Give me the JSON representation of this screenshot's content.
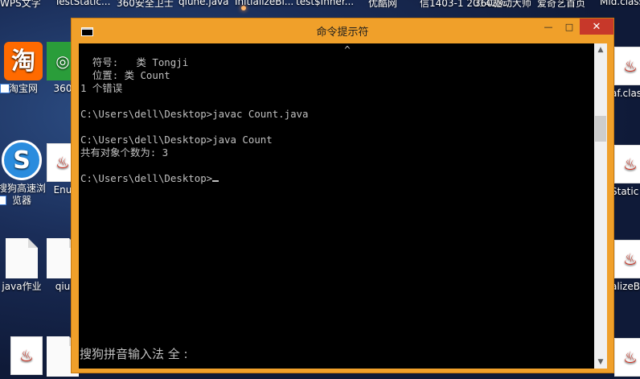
{
  "taskbar": {
    "items": [
      "WPS文字",
      "TestStatic...",
      "360安全卫士",
      "qiune.java",
      "InitializeBl...",
      "test$Inner...",
      "优酷网",
      "信1403-1 201429...",
      "360驱动大师",
      "爱奇艺首页",
      "Mid.class"
    ]
  },
  "desktop_left": [
    {
      "label": "淘宝网",
      "icon": "taobao-icon"
    },
    {
      "label": "360",
      "icon": "app-icon"
    },
    {
      "label": "搜狗高速浏览器",
      "icon": "sogou-browser-icon"
    },
    {
      "label": "Enu",
      "icon": "java-file-icon"
    },
    {
      "label": "java作业",
      "icon": "file-icon"
    },
    {
      "label": "qiu",
      "icon": "file-icon"
    }
  ],
  "desktop_right": [
    {
      "label": "af.clas",
      "icon": "java-file-icon"
    },
    {
      "label": "Static",
      "icon": "java-file-icon"
    },
    {
      "label": "alizeB",
      "icon": "java-file-icon"
    }
  ],
  "window": {
    "title": "命令提示符",
    "minimize": "—",
    "maximize": "□",
    "close": "✕"
  },
  "console": {
    "lines": [
      "                                            ^",
      "  符号:   类 Tongji",
      "  位置: 类 Count",
      "1 个错误",
      "",
      "C:\\Users\\dell\\Desktop>javac Count.java",
      "",
      "C:\\Users\\dell\\Desktop>java Count",
      "共有对象个数为: 3",
      "",
      "C:\\Users\\dell\\Desktop>"
    ],
    "ime_status": "搜狗拼音输入法 全 :"
  }
}
